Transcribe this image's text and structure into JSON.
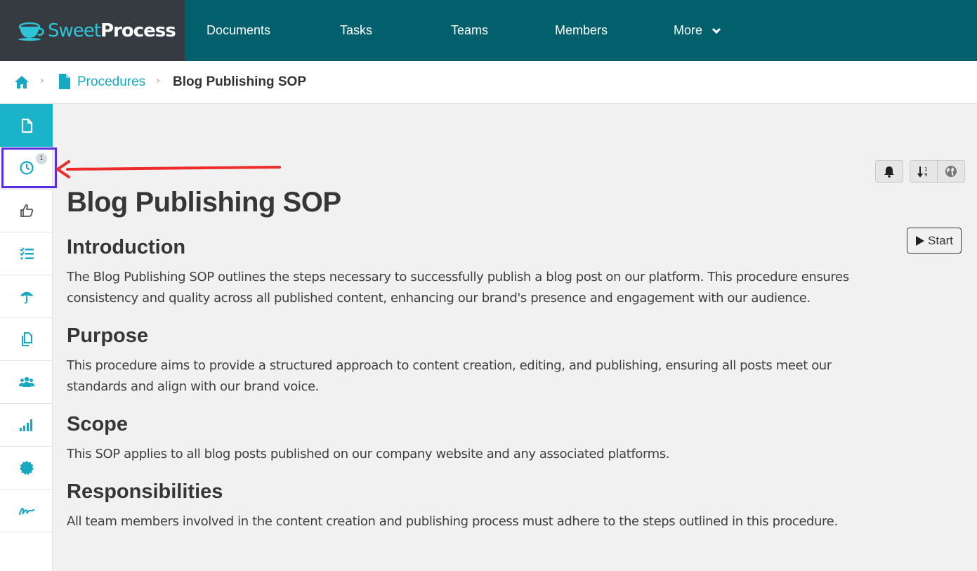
{
  "header": {
    "logo": {
      "light": "Sweet",
      "bold": "Process"
    },
    "nav": [
      {
        "label": "Documents"
      },
      {
        "label": "Tasks"
      },
      {
        "label": "Teams"
      },
      {
        "label": "Members"
      },
      {
        "label": "More"
      }
    ]
  },
  "breadcrumb": {
    "home_icon": "home-icon",
    "separator": "›",
    "section_label": "Procedures",
    "current_label": "Blog Publishing SOP"
  },
  "sidebar": {
    "items": [
      {
        "icon": "document-icon",
        "active": true
      },
      {
        "icon": "clock-icon",
        "badge": "1",
        "highlighted": true
      },
      {
        "icon": "thumbs-up-icon"
      },
      {
        "icon": "checklist-icon"
      },
      {
        "icon": "umbrella-icon"
      },
      {
        "icon": "copy-icon"
      },
      {
        "icon": "users-icon"
      },
      {
        "icon": "signal-bars-icon"
      },
      {
        "icon": "badge-icon"
      },
      {
        "icon": "signature-icon"
      }
    ]
  },
  "toolbar": {
    "start_label": "Start"
  },
  "document": {
    "title": "Blog Publishing SOP",
    "sections": [
      {
        "heading": "Introduction",
        "body": "The Blog Publishing SOP outlines the steps necessary to successfully publish a blog post on our platform. This procedure ensures consistency and quality across all published content, enhancing our brand's presence and engagement with our audience."
      },
      {
        "heading": "Purpose",
        "body": "This procedure aims to provide a structured approach to content creation, editing, and publishing, ensuring all posts meet our standards and align with our brand voice."
      },
      {
        "heading": "Scope",
        "body": "This SOP applies to all blog posts published on our company website and any associated platforms."
      },
      {
        "heading": "Responsibilities",
        "body": "All team members involved in the content creation and publishing process must adhere to the steps outlined in this procedure."
      }
    ]
  },
  "colors": {
    "nav_bg": "#025f6c",
    "logo_bg": "#363b42",
    "accent": "#1ab3c9",
    "highlight_box": "#5b2ee0",
    "annotation_arrow": "#ee2b2b"
  }
}
